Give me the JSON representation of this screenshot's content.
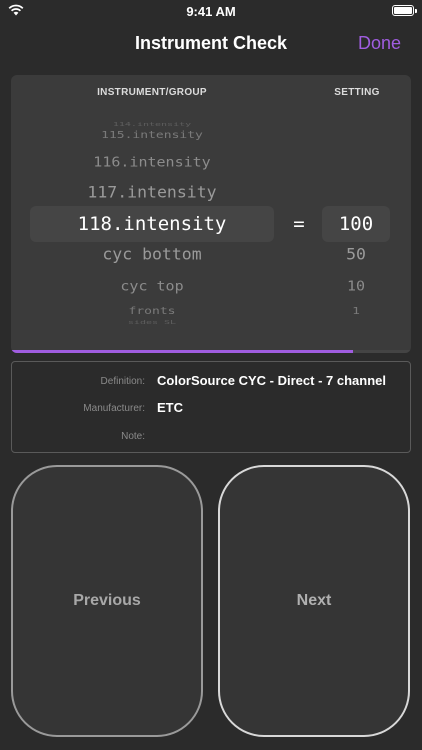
{
  "status_bar": {
    "time": "9:41 AM"
  },
  "nav": {
    "title": "Instrument Check",
    "done_label": "Done"
  },
  "picker": {
    "header_instrument": "INSTRUMENT/GROUP",
    "header_setting": "SETTING",
    "progress": 0.855,
    "rows": [
      {
        "name": "114.intensity",
        "value": "",
        "equals": ""
      },
      {
        "name": "115.intensity",
        "value": "",
        "equals": ""
      },
      {
        "name": "116.intensity",
        "value": "",
        "equals": ""
      },
      {
        "name": "117.intensity",
        "value": "",
        "equals": ""
      },
      {
        "name": "118.intensity",
        "value": "100",
        "equals": "="
      },
      {
        "name": "cyc bottom",
        "value": "50",
        "equals": ""
      },
      {
        "name": "cyc top",
        "value": "10",
        "equals": ""
      },
      {
        "name": "fronts",
        "value": "1",
        "equals": ""
      },
      {
        "name": "sides SL",
        "value": "",
        "equals": ""
      }
    ]
  },
  "info": {
    "definition_label": "Definition:",
    "definition_value": "ColorSource CYC - Direct - 7 channel",
    "manufacturer_label": "Manufacturer:",
    "manufacturer_value": "ETC",
    "note_label": "Note:",
    "note_value": ""
  },
  "buttons": {
    "previous_label": "Previous",
    "next_label": "Next"
  },
  "colors": {
    "accent": "#a05de0",
    "background": "#2b2b2b",
    "panel": "#3b3b3b"
  }
}
